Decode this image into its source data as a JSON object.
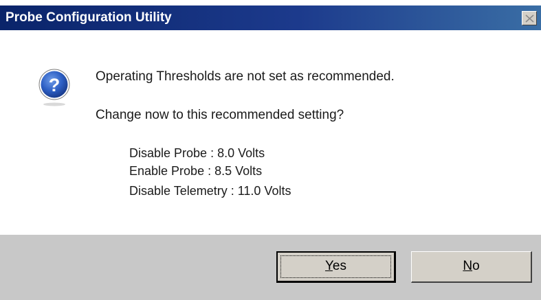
{
  "window": {
    "title": "Probe Configuration Utility",
    "close_icon": "close-icon"
  },
  "message": {
    "icon": "question-icon",
    "line1": "Operating Thresholds are not set as recommended.",
    "line2": "Change now to this recommended setting?"
  },
  "settings": [
    "Disable Probe : 8.0 Volts",
    "Enable Probe : 8.5 Volts",
    "Disable Telemetry : 11.0 Volts"
  ],
  "buttons": {
    "yes_mnemonic": "Y",
    "yes_rest": "es",
    "no_mnemonic": "N",
    "no_rest": "o"
  },
  "colors": {
    "titlebar_start": "#0a246a",
    "titlebar_end": "#3a6ea5",
    "button_face": "#d4d0c8",
    "footer_bg": "#c8c8c8"
  }
}
